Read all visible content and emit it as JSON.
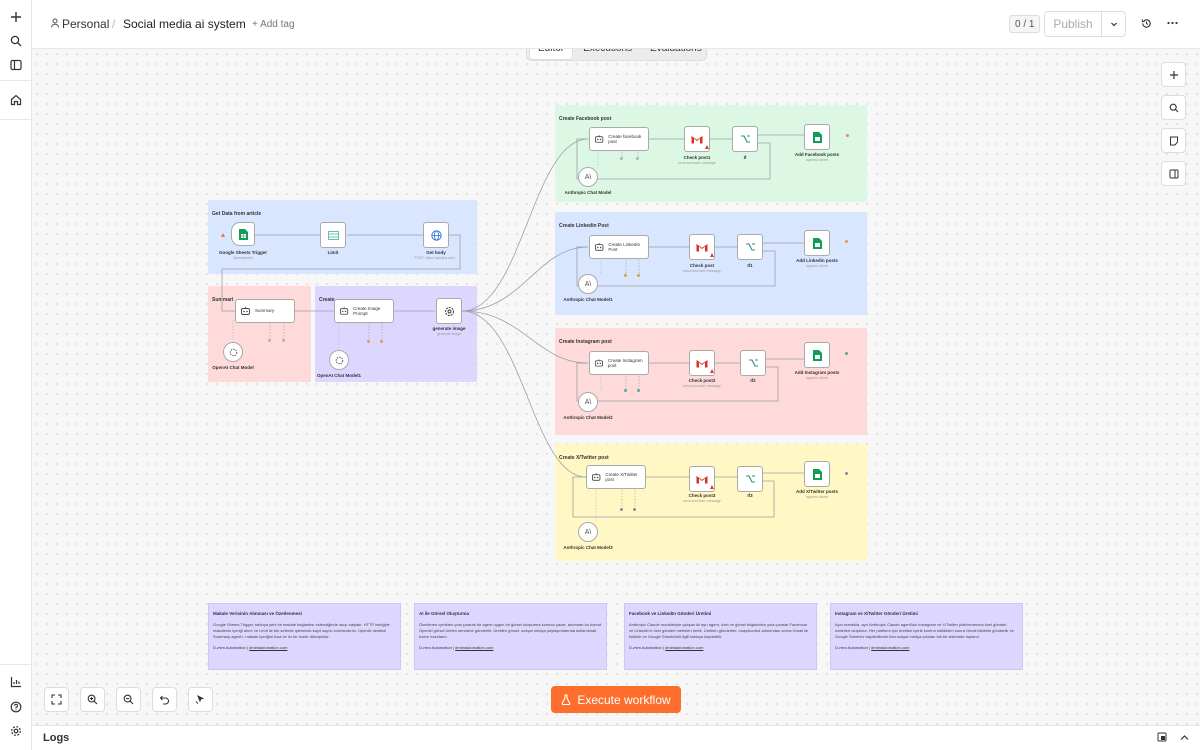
{
  "breadcrumb": {
    "owner": "Personal",
    "separator": "/",
    "workflow_name": "Social media ai system",
    "add_tag": "+ Add tag"
  },
  "header": {
    "counter": "0 / 1",
    "publish": "Publish"
  },
  "tabs": [
    {
      "label": "Editor",
      "active": true
    },
    {
      "label": "Executions",
      "active": false
    },
    {
      "label": "Evaluations",
      "active": false
    }
  ],
  "stickies": {
    "get_data": "Get Data from article",
    "summary": "Summari",
    "create_image": "Create",
    "facebook": "Create Facebook post",
    "linkedin": "Create Linkedin Post",
    "instagram": "Create Instagram post",
    "twitter": "Create X/Twitter post"
  },
  "nodes": {
    "sheets_trigger": {
      "label": "Google Sheets Trigger",
      "sub": "Spreadsheet"
    },
    "limit": {
      "label": "Limit"
    },
    "get_body": {
      "label": "Get body",
      "sub": "POST: https://api.jina.ai/s/..."
    },
    "summary": {
      "label": "Summary"
    },
    "openai_model": {
      "label": "OpenAI Chat Model"
    },
    "create_image_prompt": {
      "label": "Create Image Prompt"
    },
    "openai_model1": {
      "label": "OpenAI Chat Model1"
    },
    "generate_image": {
      "label": "generate image",
      "sub": "generate image"
    },
    "fb_agent": {
      "label": "Create facebook post"
    },
    "fb_model": {
      "label": "Anthropic Chat Model"
    },
    "fb_check": {
      "label": "Check post1",
      "sub": "send and wait: message"
    },
    "fb_if": {
      "label": "If"
    },
    "fb_add": {
      "label": "Add Facebook posts",
      "sub": "append: sheet"
    },
    "li_agent": {
      "label": "Create Linkedin Post"
    },
    "li_model": {
      "label": "Anthropic Chat Model1"
    },
    "li_check": {
      "label": "Check post",
      "sub": "send and wait: message"
    },
    "li_if": {
      "label": "If1"
    },
    "li_add": {
      "label": "Add Linkedin posts",
      "sub": "append: sheet"
    },
    "ig_agent": {
      "label": "Create Instagram post"
    },
    "ig_model": {
      "label": "Anthropic Chat Model2"
    },
    "ig_check": {
      "label": "Check post2",
      "sub": "send and wait: message"
    },
    "ig_if": {
      "label": "If2"
    },
    "ig_add": {
      "label": "Add Instagram posts",
      "sub": "append: sheet"
    },
    "tw_agent": {
      "label": "Create X/Twitter post"
    },
    "tw_model": {
      "label": "Anthropic Chat Model3"
    },
    "tw_check": {
      "label": "Check post3",
      "sub": "send and wait: message"
    },
    "tw_if": {
      "label": "If3"
    },
    "tw_add": {
      "label": "Add X/Twitter posts",
      "sub": "append: sheet"
    }
  },
  "notes": [
    {
      "title": "Makale Verisinin Alınması ve Özetlenmesi",
      "body": "Google Sheets Trigger, tabloya yeni bir makale bağlantısı eklendiğinde akışı başlatır. HTTP isteğiyle makalenin içeriği alınır ve Limit ile tek seferde işlenecek kayıt sayısı sınırlandırılır. OpenAI destekli Summary agent'ı, makale içeriğini kısa ve öz bir özete dönüştürür.",
      "footer_prefix": "D-mim Automation | ",
      "footer_link": "dmimautomation.com"
    },
    {
      "title": "AI ile Görsel Oluşturma",
      "body": "Özetlenen içerikten yola çıkarak bir agent uygun bir görsel oluşturma komutu yazar, ardından bu komut OpenAI görsel üretim servisine gönderilir. Üretilen görsel, sosyal medya paylaşımlarında kullanılmak üzere hazırlanır.",
      "footer_prefix": "D-mim Automation | ",
      "footer_link": "dmimautomation.com"
    },
    {
      "title": "Facebook ve LinkedIn Gönderi Üretimi",
      "body": "Anthropic Claude modeleriyle çalışan iki ayrı agent, özet ve görsel bilgisinden yola çıkarak Facebook ve LinkedIn'e özel gönderi metinleri üretir. Üretilen gönderiler, onay/kontrol adımından sonra Gmail ile bildirilir ve Google Sheets'teki ilgili tabloya kaydedilir.",
      "footer_prefix": "D-mim Automation | ",
      "footer_link": "dmimautomation.com"
    },
    {
      "title": "Instagram ve X/Twitter Gönderi Üretimi",
      "body": "Aynı mantıkla, ayrı Anthropic Claude agent'ları Instagram ve X/Twitter platformlarına özel gönderi metinleri oluşturur. Her platform için üretilen içerik kontrol edildikten sonra Gmail bildirimi gönderilir ve Google Sheets'e kaydedilerek tüm sosyal medya çıktıları tek bir sistemde toplanır.",
      "footer_prefix": "D-mim Automation | ",
      "footer_link": "dmimautomation.com"
    }
  ],
  "execute": {
    "label": "Execute workflow"
  },
  "logs": {
    "label": "Logs"
  },
  "colors": {
    "accent": "#ff6d2d",
    "sticky_blue": "#d9e6ff",
    "sticky_red": "#ffdada",
    "sticky_purple": "#ddd6ff",
    "sticky_green": "#dcf7e4",
    "sticky_yellow": "#fff8c4"
  }
}
